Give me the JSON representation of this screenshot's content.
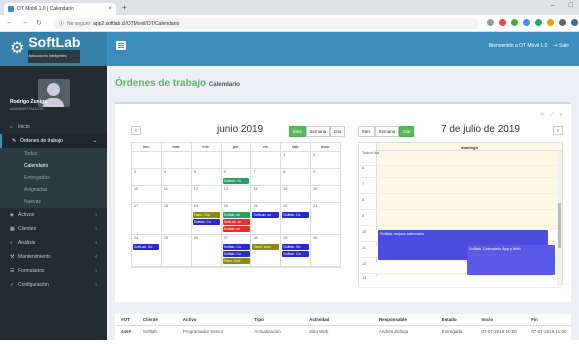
{
  "browser": {
    "tab_title": "OT Mobil 1.0 | Calendario",
    "url_security": "No seguro",
    "url": "app2.softlab.cl/OTMovil/OT/Calendario"
  },
  "brand": {
    "name": "SoftLab",
    "tagline": "Aplicaciones inteligentes"
  },
  "user": {
    "name": "Rodrigo Zuniga",
    "role": "ADMINISTRADOR"
  },
  "menu": {
    "inicio": "Inicio",
    "ordenes": "Órdenes de trabajo",
    "todas": "Todas",
    "calendario": "Calendario",
    "entregadas": "Entregadas",
    "asignadas": "Asignadas",
    "nuevas": "Nuevas",
    "activos": "Activos",
    "clientes": "Clientes",
    "analisis": "Análisis",
    "mantenimiento": "Mantenimiento",
    "formularios": "Formularios",
    "configuracion": "Configuración"
  },
  "topbar": {
    "welcome": "Bienvenido a OT Móvil 1.0",
    "logout": "Salir"
  },
  "page": {
    "title": "Órdenes de trabajo",
    "subtitle": "Calendario"
  },
  "month": {
    "title": "junio 2019",
    "prev": "‹",
    "views": [
      "Mes",
      "Semana",
      "Día"
    ],
    "days": [
      "lun.",
      "mar.",
      "mié.",
      "jue.",
      "vie.",
      "sáb.",
      "dom."
    ],
    "weeks": [
      [
        "",
        "",
        "",
        "",
        "",
        "1",
        "2"
      ],
      [
        "3",
        "4",
        "5",
        "6",
        "7",
        "8",
        "9"
      ],
      [
        "10",
        "11",
        "12",
        "13",
        "14",
        "15",
        "16"
      ],
      [
        "17",
        "18",
        "19",
        "20",
        "21",
        "22",
        "23"
      ],
      [
        "24",
        "25",
        "26",
        "27",
        "28",
        "29",
        "30"
      ]
    ]
  },
  "events": {
    "e1": "Softech. Ni",
    "e2": "Twen. Clin",
    "e3": "Softlab. sn",
    "e4": "Softlab. Cc",
    "e5": "SoftLab. sn",
    "e6": "Softlab. sn",
    "e7": "SoftLab. sn",
    "e8": "Softlab. Cc",
    "e9": "SoftLab. Sn",
    "e10": "Softlab. sn",
    "e11": "Softlab. Cu",
    "e12": "Twen. com",
    "e13": "Softlab. Sn",
    "e14": "Softlab. Co",
    "e15": "Softlab. Co",
    "e16": "Twen. Cod"
  },
  "day": {
    "title": "7 de julio de 2019",
    "next": "›",
    "views": [
      "Mes",
      "Semana",
      "Día"
    ],
    "dayname": "domingo",
    "allday": "Todo el día",
    "hours": [
      "6",
      "7",
      "8",
      "9",
      "10",
      "11",
      "12",
      "13"
    ],
    "ev1": "Softlab. mejora calendario",
    "ev2": "Softlab. Calendario App y Web"
  },
  "table": {
    "headers": [
      "#OT",
      "Cliente",
      "Activo",
      "Tipo",
      "Actividad",
      "Responsable",
      "Estado",
      "Inicio",
      "Fin"
    ],
    "row": [
      "4469",
      "Softlab",
      "Programador Senior",
      "Actualización",
      "Sitio Web",
      "Andrés Zúñiga",
      "Entregada",
      "07-07-2019 10:00",
      "07-07-2019 11:00"
    ]
  }
}
